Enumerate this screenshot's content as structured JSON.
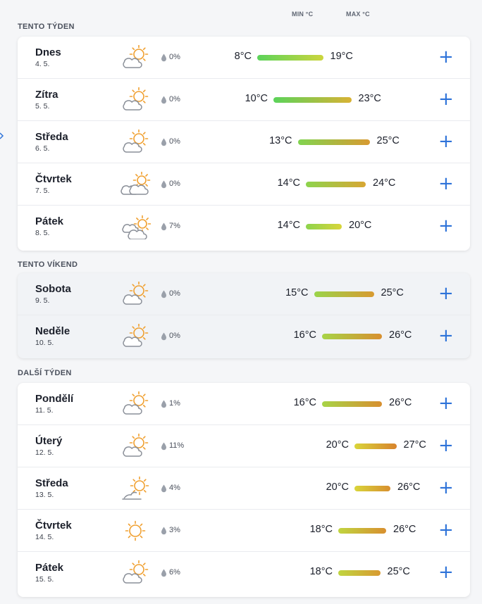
{
  "columns": {
    "min_label": "MIN °C",
    "max_label": "MAX °C"
  },
  "sections": [
    {
      "title": "TENTO TÝDEN",
      "variant": "normal",
      "days": [
        {
          "day": "Dnes",
          "date": "4. 5.",
          "icon": "partly-sunny-icon",
          "precip": "0%",
          "min": "8°C",
          "max": "19°C",
          "min_val": 8,
          "max_val": 19
        },
        {
          "day": "Zítra",
          "date": "5. 5.",
          "icon": "partly-sunny-icon",
          "precip": "0%",
          "min": "10°C",
          "max": "23°C",
          "min_val": 10,
          "max_val": 23
        },
        {
          "day": "Středa",
          "date": "6. 5.",
          "icon": "partly-sunny-icon",
          "precip": "0%",
          "min": "13°C",
          "max": "25°C",
          "min_val": 13,
          "max_val": 25
        },
        {
          "day": "Čtvrtek",
          "date": "7. 5.",
          "icon": "cloudy-sunny-icon",
          "precip": "0%",
          "min": "14°C",
          "max": "24°C",
          "min_val": 14,
          "max_val": 24
        },
        {
          "day": "Pátek",
          "date": "8. 5.",
          "icon": "mostly-cloudy-icon",
          "precip": "7%",
          "min": "14°C",
          "max": "20°C",
          "min_val": 14,
          "max_val": 20
        }
      ]
    },
    {
      "title": "TENTO VÍKEND",
      "variant": "weekend",
      "days": [
        {
          "day": "Sobota",
          "date": "9. 5.",
          "icon": "partly-sunny-icon",
          "precip": "0%",
          "min": "15°C",
          "max": "25°C",
          "min_val": 15,
          "max_val": 25
        },
        {
          "day": "Neděle",
          "date": "10. 5.",
          "icon": "partly-sunny-icon",
          "precip": "0%",
          "min": "16°C",
          "max": "26°C",
          "min_val": 16,
          "max_val": 26
        }
      ]
    },
    {
      "title": "DALŠÍ TÝDEN",
      "variant": "normal",
      "days": [
        {
          "day": "Pondělí",
          "date": "11. 5.",
          "icon": "partly-sunny-icon",
          "precip": "1%",
          "min": "16°C",
          "max": "26°C",
          "min_val": 16,
          "max_val": 26
        },
        {
          "day": "Úterý",
          "date": "12. 5.",
          "icon": "partly-sunny-icon",
          "precip": "11%",
          "min": "20°C",
          "max": "27°C",
          "min_val": 20,
          "max_val": 27
        },
        {
          "day": "Středa",
          "date": "13. 5.",
          "icon": "sunny-haze-icon",
          "precip": "4%",
          "min": "20°C",
          "max": "26°C",
          "min_val": 20,
          "max_val": 26
        },
        {
          "day": "Čtvrtek",
          "date": "14. 5.",
          "icon": "sunny-icon",
          "precip": "3%",
          "min": "18°C",
          "max": "26°C",
          "min_val": 18,
          "max_val": 26
        },
        {
          "day": "Pátek",
          "date": "15. 5.",
          "icon": "partly-sunny-icon",
          "precip": "6%",
          "min": "18°C",
          "max": "25°C",
          "min_val": 18,
          "max_val": 25
        }
      ]
    }
  ],
  "colors": {
    "accent": "#2e73d9",
    "cold": "#5bd35a",
    "mild": "#d9d53a",
    "warm": "#d8832d",
    "sun": "#f0a030",
    "cloud": "#8a8f98"
  }
}
